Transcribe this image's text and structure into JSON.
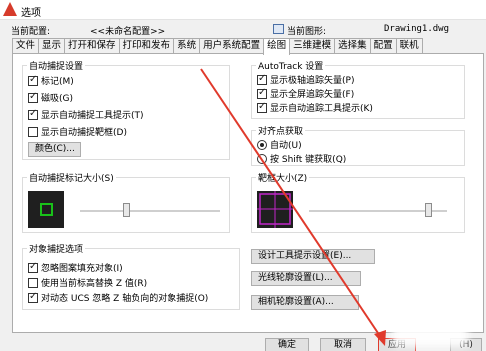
{
  "window": {
    "title": "选项"
  },
  "config_row": {
    "current_profile_label": "当前配置:",
    "current_profile_value": "<<未命名配置>>",
    "current_drawing_label": "当前图形:",
    "current_drawing_value": "Drawing1.dwg"
  },
  "tabs": [
    "文件",
    "显示",
    "打开和保存",
    "打印和发布",
    "系统",
    "用户系统配置",
    "绘图",
    "三维建模",
    "选择集",
    "配置",
    "联机"
  ],
  "active_tab": "绘图",
  "autosnap": {
    "title": "自动捕捉设置",
    "items": [
      {
        "label": "标记(M)",
        "checked": true
      },
      {
        "label": "磁吸(G)",
        "checked": true
      },
      {
        "label": "显示自动捕捉工具提示(T)",
        "checked": true
      },
      {
        "label": "显示自动捕捉靶框(D)",
        "checked": false
      }
    ],
    "color_button": "颜色(C)..."
  },
  "autotrack": {
    "title": "AutoTrack 设置",
    "items": [
      {
        "label": "显示极轴追踪矢量(P)",
        "checked": true
      },
      {
        "label": "显示全屏追踪矢量(F)",
        "checked": true
      },
      {
        "label": "显示自动追踪工具提示(K)",
        "checked": true
      }
    ]
  },
  "alignment": {
    "title": "对齐点获取",
    "options": [
      {
        "label": "自动(U)",
        "selected": true
      },
      {
        "label": "按 Shift 键获取(Q)",
        "selected": false
      }
    ]
  },
  "marker_size": {
    "title": "自动捕捉标记大小(S)",
    "level": 0.33
  },
  "aperture_size": {
    "title": "靶框大小(Z)",
    "level": 0.8
  },
  "object_snap": {
    "title": "对象捕捉选项",
    "items": [
      {
        "label": "忽略图案填充对象(I)",
        "checked": true
      },
      {
        "label": "使用当前标高替换 Z 值(R)",
        "checked": false
      },
      {
        "label": "对动态 UCS 忽略 Z 轴负向的对象捕捉(O)",
        "checked": true
      }
    ]
  },
  "side_buttons": {
    "tooltip": "设计工具提示设置(E)...",
    "lightglyph": "光线轮廓设置(L)...",
    "camera": "相机轮廓设置(A)..."
  },
  "dialog_buttons": {
    "ok": "确定",
    "cancel": "取消",
    "apply": "应用",
    "help": "(H)"
  },
  "colors": {
    "annotation": "#e03a2c",
    "marker": "#19c219",
    "aperture": "#c026c8"
  }
}
